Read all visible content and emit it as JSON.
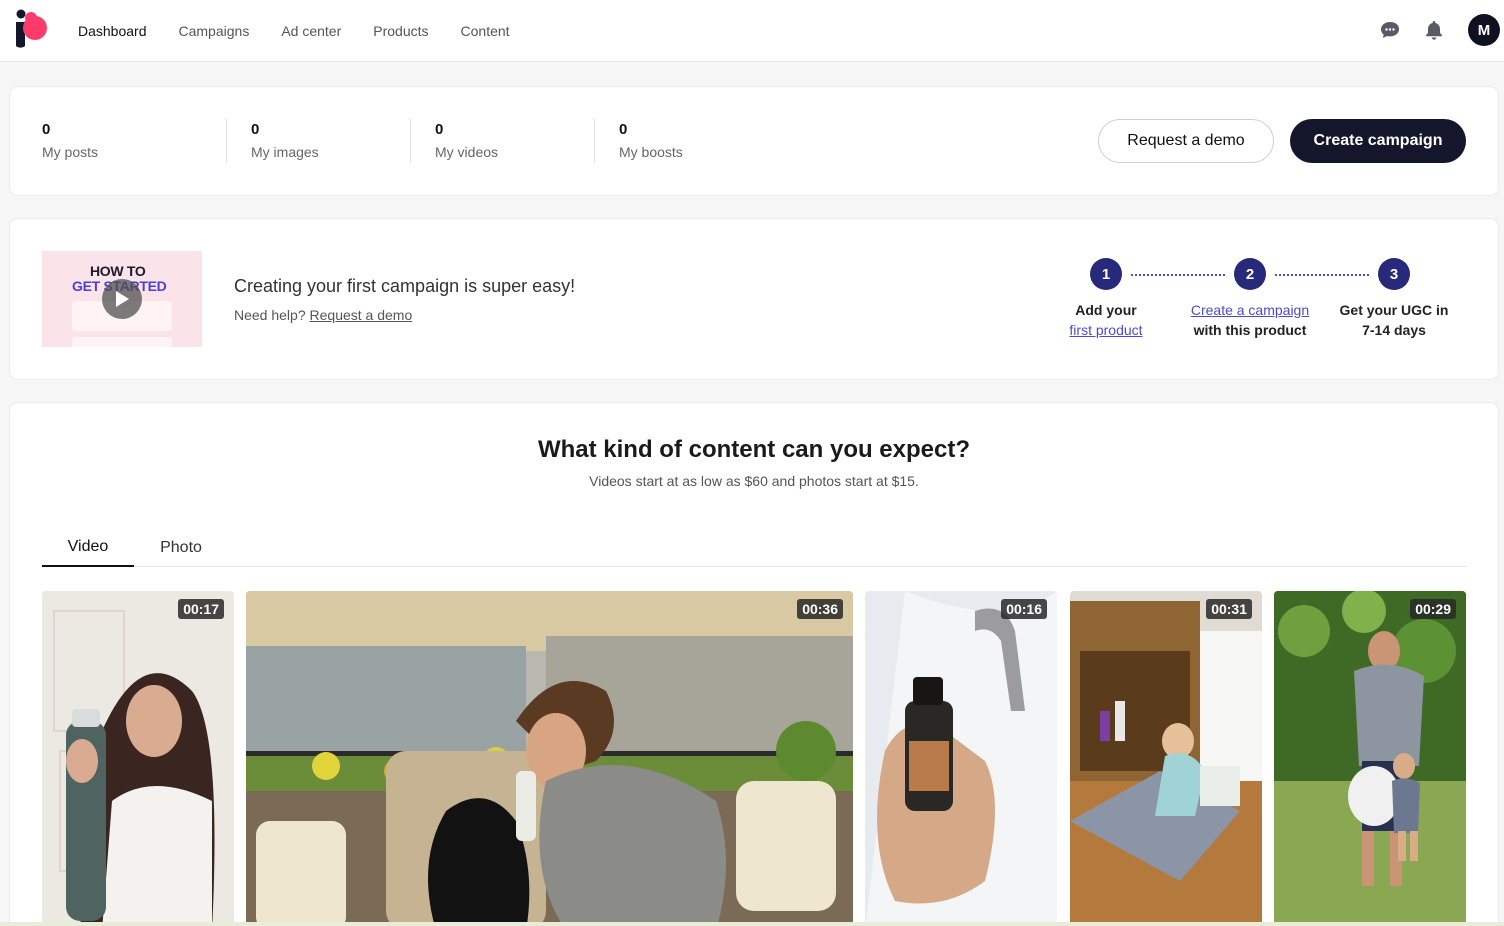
{
  "nav": {
    "items": [
      "Dashboard",
      "Campaigns",
      "Ad center",
      "Products",
      "Content"
    ],
    "active": "Dashboard",
    "avatar_initial": "M"
  },
  "stats": {
    "items": [
      {
        "value": "0",
        "label": "My posts"
      },
      {
        "value": "0",
        "label": "My images"
      },
      {
        "value": "0",
        "label": "My videos"
      },
      {
        "value": "0",
        "label": "My boosts"
      }
    ],
    "request_demo": "Request a demo",
    "create_campaign": "Create campaign"
  },
  "howto": {
    "thumb_line1": "HOW TO",
    "thumb_line2": "GET STARTED",
    "title": "Creating your first campaign is super easy!",
    "help_prefix": "Need help?",
    "help_link": "Request a demo",
    "steps": [
      {
        "num": "1",
        "line1": "Add your",
        "link": "first product",
        "line2": ""
      },
      {
        "num": "2",
        "line1": "",
        "link": "Create a campaign",
        "line2": "with this product"
      },
      {
        "num": "3",
        "line1": "Get your UGC in",
        "link": "",
        "line2": "7-14 days"
      }
    ]
  },
  "content": {
    "title": "What kind of content can you expect?",
    "subtitle": "Videos start at as low as $60 and photos start at $15.",
    "tabs": [
      "Video",
      "Photo"
    ],
    "active_tab": "Video",
    "videos": [
      {
        "duration": "00:17"
      },
      {
        "duration": "00:36"
      },
      {
        "duration": "00:16"
      },
      {
        "duration": "00:31"
      },
      {
        "duration": "00:29"
      }
    ]
  },
  "colors": {
    "brand_pink": "#ff3b6b",
    "dark": "#14172b",
    "step": "#272a7a",
    "link": "#4a4bd0"
  }
}
